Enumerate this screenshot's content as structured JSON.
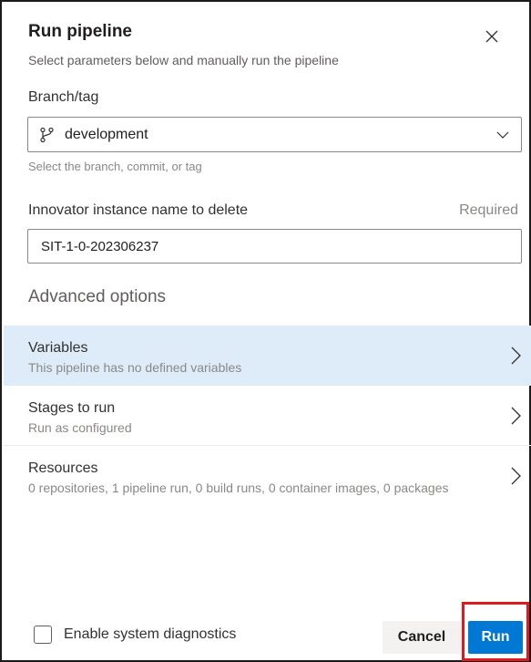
{
  "dialog": {
    "title": "Run pipeline",
    "subtitle": "Select parameters below and manually run the pipeline"
  },
  "branch": {
    "label": "Branch/tag",
    "value": "development",
    "hint": "Select the branch, commit, or tag"
  },
  "instance": {
    "label": "Innovator instance name to delete",
    "required": "Required",
    "value": "SIT-1-0-202306237"
  },
  "advanced": {
    "title": "Advanced options",
    "rows": [
      {
        "title": "Variables",
        "subtitle": "This pipeline has no defined variables"
      },
      {
        "title": "Stages to run",
        "subtitle": "Run as configured"
      },
      {
        "title": "Resources",
        "subtitle": "0 repositories, 1 pipeline run, 0 build runs, 0 container images, 0 packages"
      }
    ]
  },
  "footer": {
    "diagnostics_label": "Enable system diagnostics",
    "cancel_label": "Cancel",
    "run_label": "Run"
  },
  "colors": {
    "accent": "#0078d4",
    "selected_row": "#deecf9",
    "highlight": "#e0191f"
  }
}
